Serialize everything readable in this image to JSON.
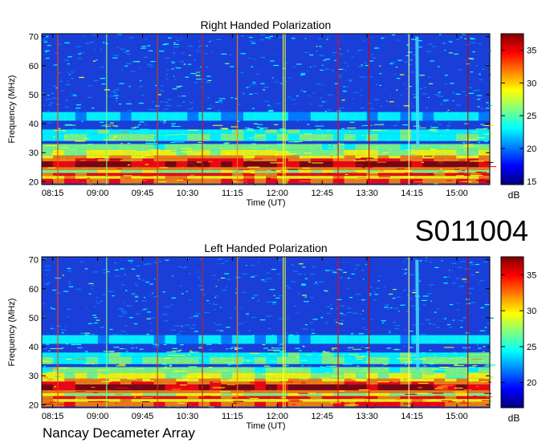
{
  "station_id": "S011004",
  "footer": "Nancay Decameter Array",
  "colormap": [
    "#00007f",
    "#0000ff",
    "#0080ff",
    "#00ffff",
    "#80ff80",
    "#ffff00",
    "#ff8000",
    "#ff0000",
    "#7f0000"
  ],
  "chart_data": [
    {
      "type": "heatmap",
      "title": "Right Handed Polarization",
      "xlabel": "Time (UT)",
      "ylabel": "Frequency (MHz)",
      "x_ticks": [
        "08:15",
        "09:00",
        "09:45",
        "10:30",
        "11:15",
        "12:00",
        "12:45",
        "13:30",
        "14:15",
        "15:00"
      ],
      "x_range": [
        "08:04",
        "15:33"
      ],
      "y_ticks": [
        20,
        30,
        40,
        50,
        60,
        70
      ],
      "ylim": [
        19,
        71
      ],
      "colorbar": {
        "label": "dB",
        "ticks": [
          15,
          20,
          25,
          30,
          35
        ],
        "range": [
          14.5,
          37.5
        ]
      },
      "features": {
        "intense_band_MHz": [
          21,
          29
        ],
        "burst_time": "14:20",
        "vertical_lines": [
          "08:20",
          "09:09",
          "10:00",
          "10:45",
          "11:20",
          "12:06",
          "12:08",
          "13:01",
          "13:32",
          "14:12",
          "15:11"
        ]
      }
    },
    {
      "type": "heatmap",
      "title": "Left Handed Polarization",
      "xlabel": "Time (UT)",
      "ylabel": "Frequency (MHz)",
      "x_ticks": [
        "08:15",
        "09:00",
        "09:45",
        "10:30",
        "11:15",
        "12:00",
        "12:45",
        "13:30",
        "14:15",
        "15:00"
      ],
      "x_range": [
        "08:04",
        "15:33"
      ],
      "y_ticks": [
        20,
        30,
        40,
        50,
        60,
        70
      ],
      "ylim": [
        19,
        71
      ],
      "colorbar": {
        "label": "dB",
        "ticks": [
          20,
          25,
          30,
          35
        ],
        "range": [
          16.5,
          37.5
        ]
      },
      "features": {
        "intense_band_MHz": [
          21,
          29
        ],
        "burst_time": "14:20",
        "vertical_lines": [
          "08:20",
          "09:09",
          "10:00",
          "10:45",
          "11:20",
          "12:06",
          "12:08",
          "13:01",
          "13:32",
          "14:12",
          "15:11"
        ]
      }
    }
  ]
}
